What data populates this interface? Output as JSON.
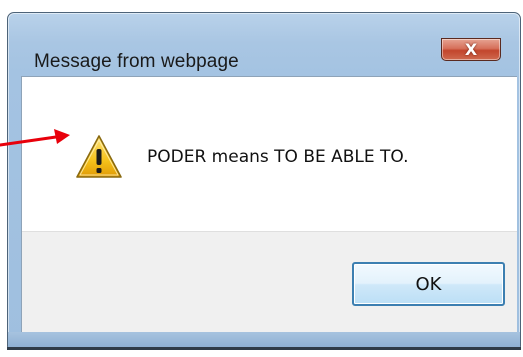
{
  "window": {
    "title": "Message from webpage",
    "close_label": "X"
  },
  "dialog": {
    "icon": "warning-icon",
    "message": "PODER means TO BE ABLE TO.",
    "ok_label": "OK"
  },
  "colors": {
    "annotation_arrow": "#e8000b",
    "close_button": "#c7472e",
    "ok_border": "#3c7fb1",
    "warning_fill": "#f5c21b"
  }
}
